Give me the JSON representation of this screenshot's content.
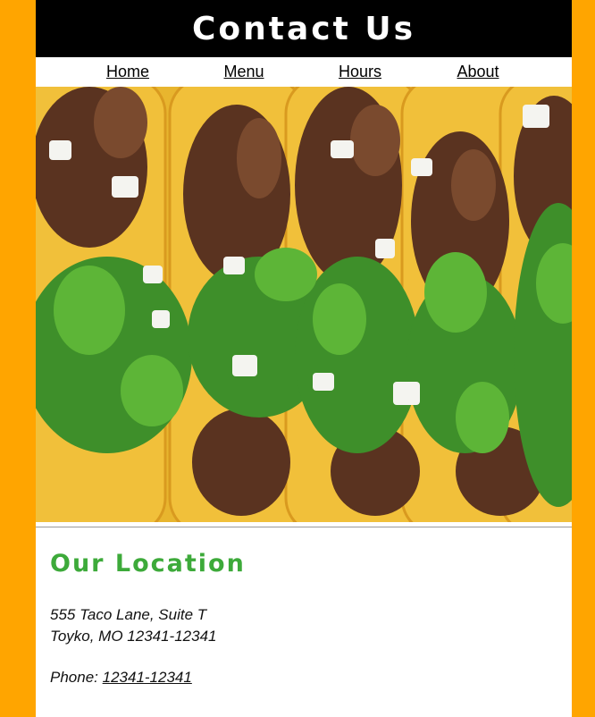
{
  "header": {
    "title": "Contact Us"
  },
  "nav": {
    "items": [
      {
        "label": "Home"
      },
      {
        "label": "Menu"
      },
      {
        "label": "Hours"
      },
      {
        "label": "About"
      }
    ]
  },
  "hero": {
    "image_subject": "tacos with beef, onion and cilantro"
  },
  "location": {
    "heading": "Our Location",
    "address_line1": "555 Taco Lane, Suite T",
    "address_line2": "Toyko, MO 12341-12341",
    "phone_label": "Phone:",
    "phone_number": "12341-12341"
  },
  "colors": {
    "background": "#FFA500",
    "header_bg": "#000000",
    "heading_green": "#3DAA3A",
    "tortilla": "#E8B52E",
    "beef": "#5A3320",
    "cilantro": "#3E8F2A"
  }
}
